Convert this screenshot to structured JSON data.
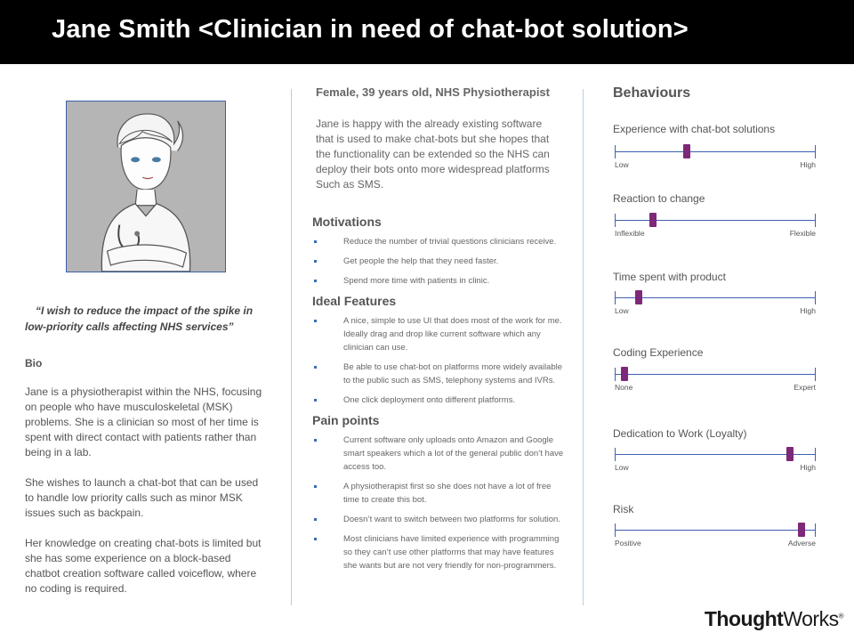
{
  "title": "Jane Smith <Clinician in need of chat-bot solution>",
  "quote": "“I wish to reduce the impact of the spike in low-priority calls affecting NHS services”",
  "bio": {
    "title": "Bio",
    "paragraphs": [
      "Jane is a physiotherapist within the NHS, focusing on people who have musculoskeletal (MSK) problems. She is a clinician so most of her time is spent with direct contact with patients rather than being in a lab.",
      "She wishes to launch a chat-bot that can be used to handle low priority calls such as minor MSK issues such as backpain.",
      "Her knowledge on creating chat-bots is limited but she has some experience on a block-based chatbot creation software called voiceflow, where no coding is required."
    ]
  },
  "profile": {
    "subtitle": "Female, 39 years old, NHS Physiotherapist",
    "intro": "Jane is happy with the already existing software that is used to make chat-bots but she hopes that the functionality can be extended so the NHS can deploy their bots onto more widespread platforms Such as SMS."
  },
  "motivations": {
    "title": "Motivations",
    "items": [
      "Reduce the number of trivial questions clinicians receive.",
      "Get people the help that they need faster.",
      "Spend more time with patients in clinic."
    ]
  },
  "ideal_features": {
    "title": "Ideal Features",
    "items": [
      "A nice, simple to use UI that does most of the work for me. Ideally drag and drop like current software which any clinician can use.",
      "Be able to use chat-bot on platforms more widely available to the public such as SMS, telephony systems and IVRs.",
      "One click deployment onto different platforms."
    ]
  },
  "pain_points": {
    "title": "Pain points",
    "items": [
      "Current software only uploads onto Amazon and Google smart speakers which a lot of the general public don’t have access too.",
      "A physiotherapist first so she does not have a lot of free time to create this bot.",
      "Doesn’t want to switch between two platforms for solution.",
      "Most clinicians have limited experience with programming so they can’t use other platforms that may have features she wants but are not very friendly for non-programmers."
    ]
  },
  "behaviours": {
    "title": "Behaviours",
    "scales": [
      {
        "label": "Experience with chat-bot solutions",
        "low": "Low",
        "high": "High",
        "value": 0.36
      },
      {
        "label": "Reaction to change",
        "low": "Inflexible",
        "high": "Flexible",
        "value": 0.19
      },
      {
        "label": "Time spent with product",
        "low": "Low",
        "high": "High",
        "value": 0.12
      },
      {
        "label": "Coding Experience",
        "low": "None",
        "high": "Expert",
        "value": 0.05
      },
      {
        "label": "Dedication to Work (Loyalty)",
        "low": "Low",
        "high": "High",
        "value": 0.87
      },
      {
        "label": "Risk",
        "low": "Positive",
        "high": "Adverse",
        "value": 0.93
      }
    ]
  },
  "logo": {
    "bold": "Thought",
    "regular": "Works",
    "mark": "®"
  },
  "colors": {
    "accent": "#7d2878",
    "track": "#3f5fb0",
    "header_bg": "#000000"
  }
}
